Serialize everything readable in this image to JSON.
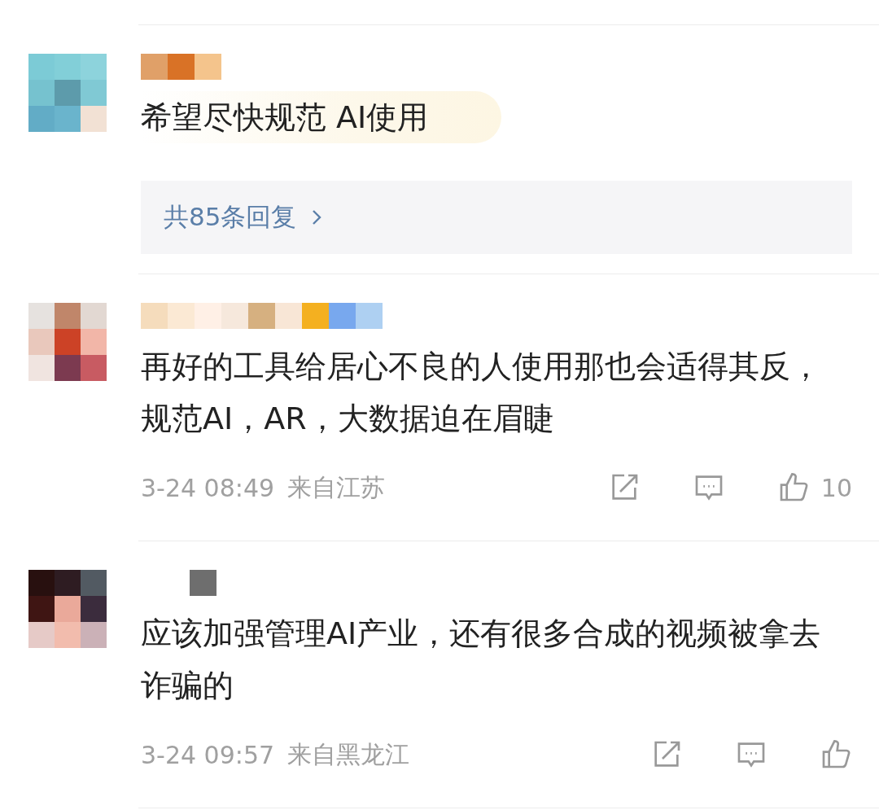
{
  "comments": [
    {
      "text": "希望尽快规范 AI使用",
      "highlighted": true,
      "replies": "共85条回复"
    },
    {
      "text": "再好的工具给居心不良的人使用那也会适得其反，规范AI，AR，大数据迫在眉睫",
      "highlighted": false,
      "time": "3-24 08:49",
      "location": "来自江苏",
      "likes": "10"
    },
    {
      "text": "应该加强管理AI产业，还有很多合成的视频被拿去诈骗的",
      "highlighted": false,
      "time": "3-24 09:57",
      "location": "来自黑龙江"
    }
  ]
}
